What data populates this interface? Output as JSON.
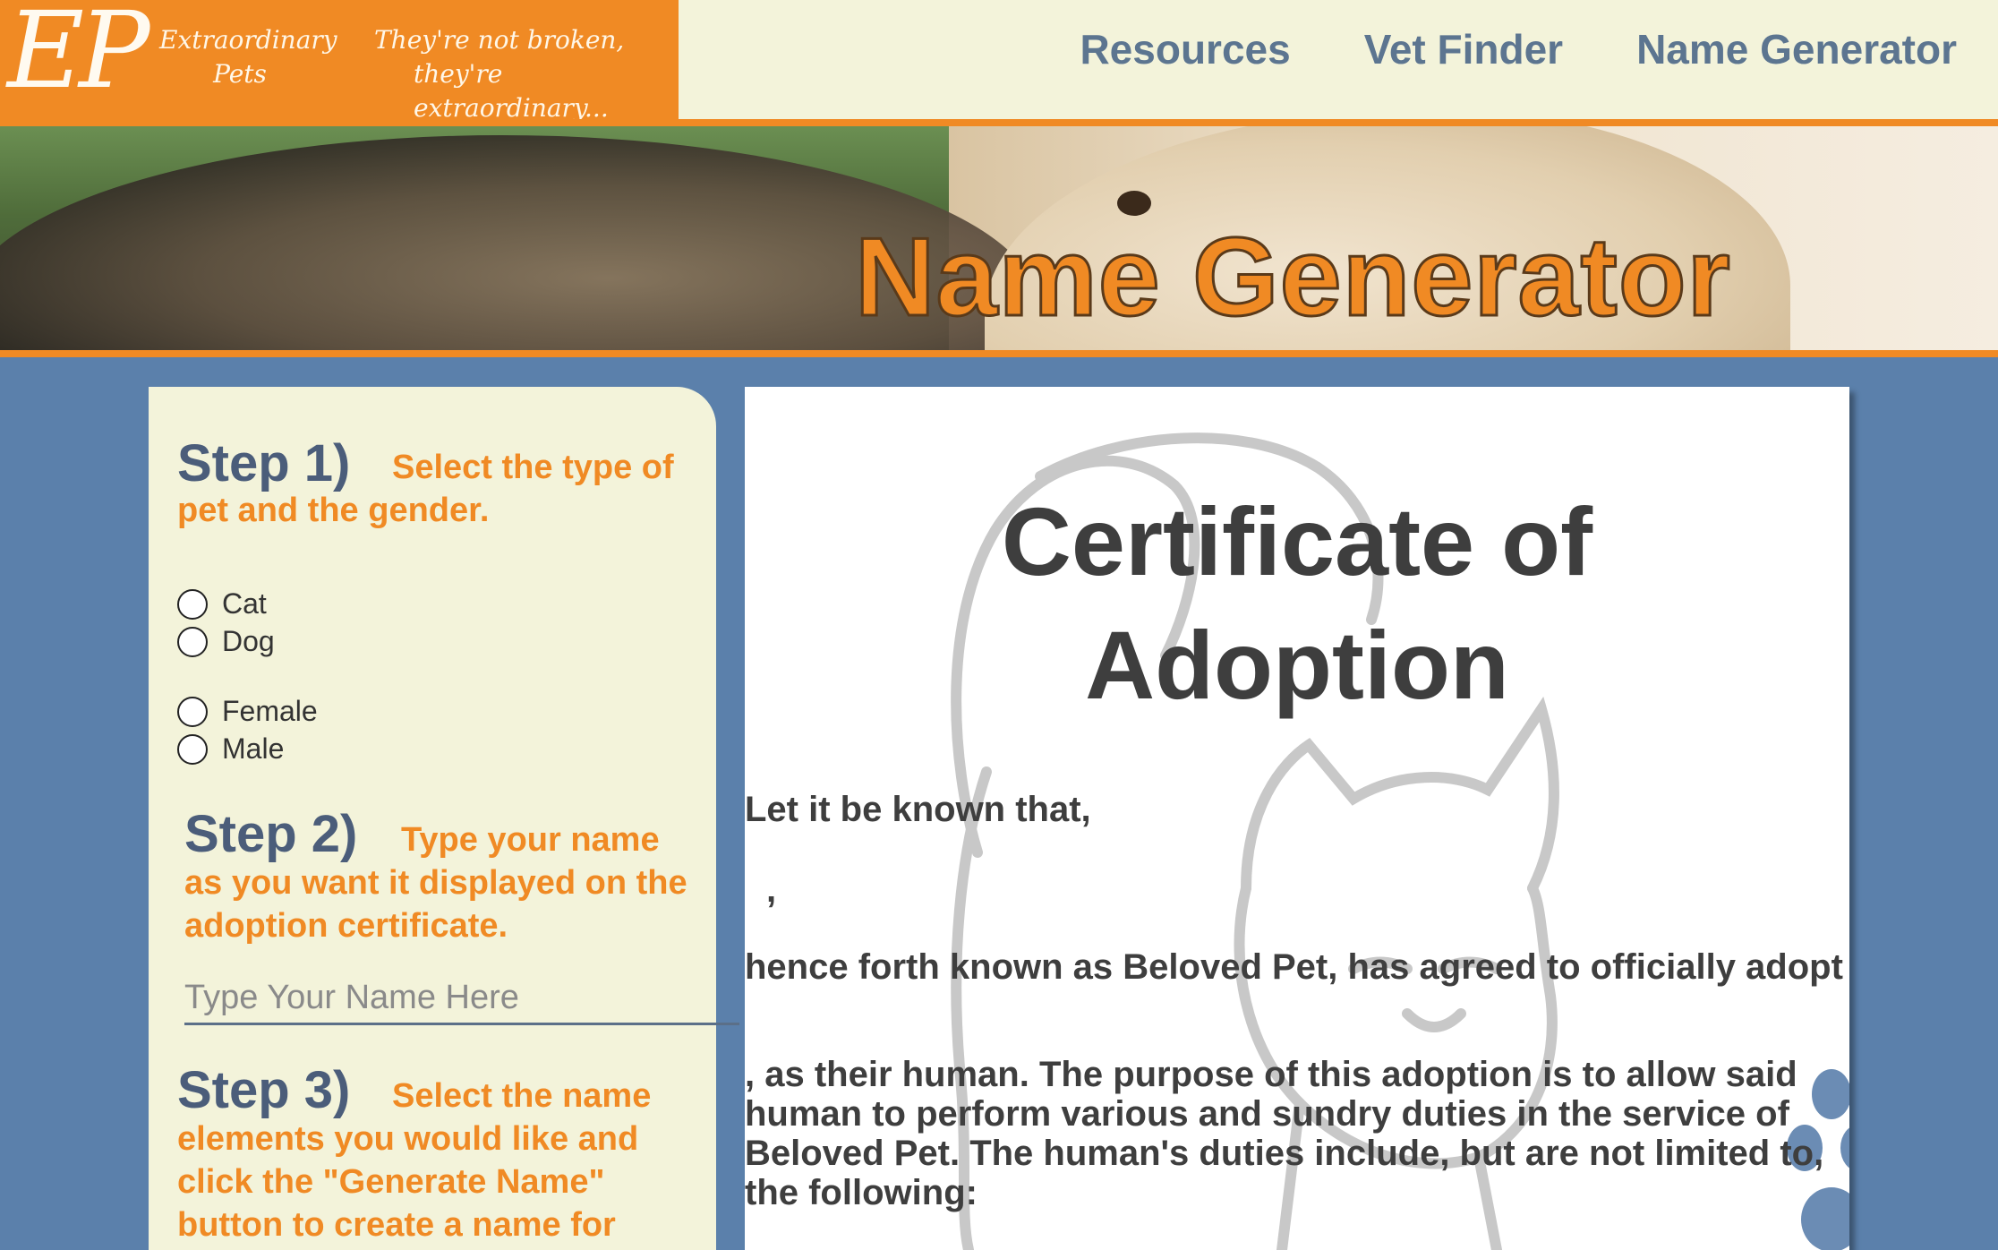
{
  "brand": {
    "logo": "EP",
    "name_line1": "Extraordinary",
    "name_line2": "Pets",
    "tagline_line1": "They're not broken,",
    "tagline_line2": "they're extraordinary..."
  },
  "nav": {
    "items": [
      "Resources",
      "Vet Finder",
      "Name Generator"
    ]
  },
  "banner": {
    "title": "Name Generator"
  },
  "steps": {
    "step1": {
      "title": "Step 1)",
      "desc": "Select the type of pet and the gender."
    },
    "pet_types": [
      "Cat",
      "Dog"
    ],
    "genders": [
      "Female",
      "Male"
    ],
    "step2": {
      "title": "Step 2)",
      "desc": "Type your name as you want it displayed on the adoption certificate.",
      "input_placeholder": "Type Your Name Here",
      "input_value": ""
    },
    "step3": {
      "title": "Step 3)",
      "desc": "Select the name elements you would like and click the \"Generate Name\" button to create a name for"
    }
  },
  "certificate": {
    "title_line1": "Certificate of",
    "title_line2": "Adoption",
    "line1": "Let it be known that,",
    "comma": ",",
    "line2": "hence forth known as Beloved Pet, has agreed to officially adopt",
    "paragraph": ", as their human. The purpose of this adoption is to allow said human to perform various and sundry duties in the service of Beloved Pet. The human's duties include, but are not limited to, the following:"
  },
  "colors": {
    "orange": "#f08a24",
    "cream": "#f3f3da",
    "blue_bg": "#5b80ab",
    "nav_text": "#5c7590",
    "step_title": "#4b5d7a"
  }
}
